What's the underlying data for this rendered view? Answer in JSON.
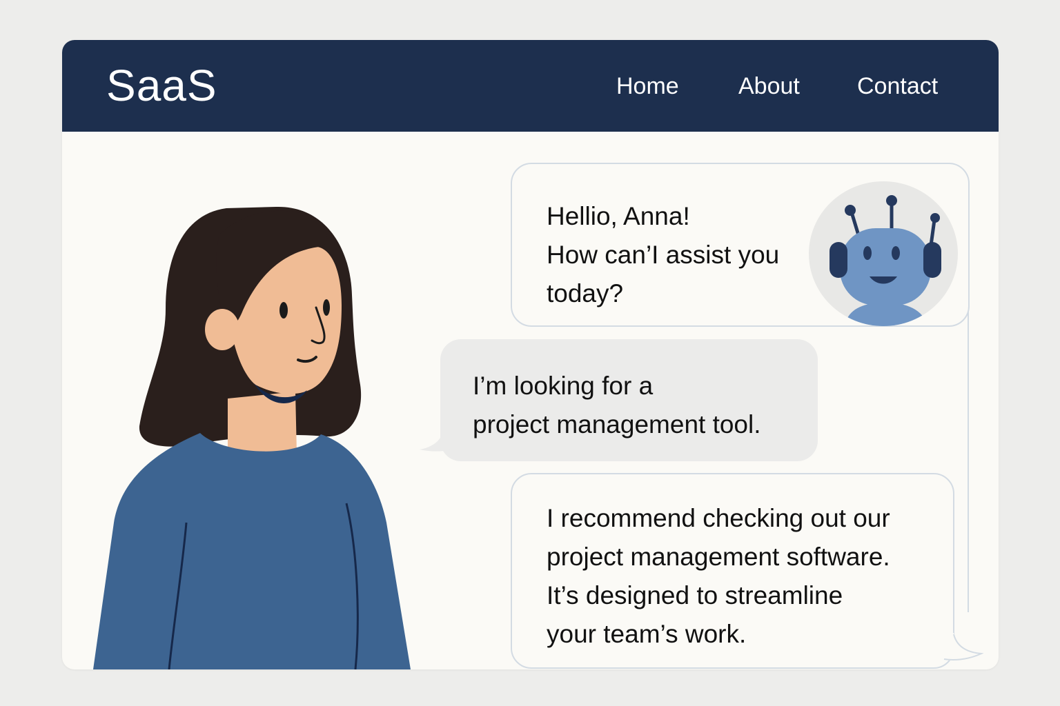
{
  "header": {
    "brand": "SaaS",
    "nav": {
      "home": "Home",
      "about": "About",
      "contact": "Contact"
    }
  },
  "chat": {
    "bot_message_1": {
      "lines": [
        "Hellio, Anna!",
        "How can’I assist you",
        "today?"
      ]
    },
    "user_message": {
      "lines": [
        "I’m looking for a",
        "project management tool."
      ]
    },
    "bot_message_2": {
      "lines": [
        "I recommend checking out our",
        "project management software.",
        "It’s designed to streamline",
        "your team’s work."
      ]
    }
  },
  "icons": {
    "bot_avatar": "robot-icon",
    "user": "woman-illustration"
  },
  "colors": {
    "nav_bg": "#1d2f4e",
    "page_bg": "#fbfaf6",
    "user_bubble": "#ebebea",
    "bubble_border": "#d3dbe3",
    "robot": "#6f95c4",
    "sweater": "#3d6491"
  }
}
